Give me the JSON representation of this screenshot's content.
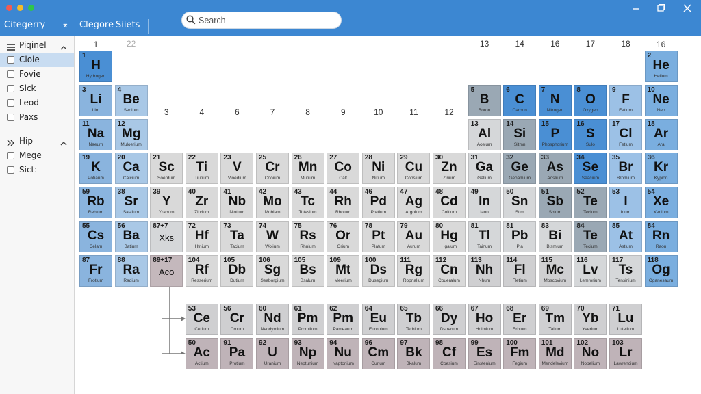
{
  "titlebar": {
    "left_label": "Citegerry",
    "collapse_symbol": "⌅",
    "tab_category": "Clegore",
    "tab_sheets": "Siiets",
    "search_placeholder": "Search"
  },
  "sidebar": {
    "sections": [
      {
        "label": "Piqinel",
        "items": [
          "Cloie",
          "Fovie",
          "Slck",
          "Leod",
          "Paxs"
        ]
      },
      {
        "label": "Hip",
        "items": [
          "Mege",
          "Sict:"
        ]
      }
    ],
    "selected_item": "Cloie"
  },
  "colors": {
    "titlebar": "#3c87d2",
    "alkali": "#8ab4de",
    "alkaline": "#a9c8e6",
    "transition": "#d9d9d9",
    "hydrogen": "#4a8fd4",
    "nonmetal": "#4a8fd4",
    "metalloid": "#9aa8b4",
    "halogen": "#9cc1e6",
    "noble": "#7aaedf",
    "post": "#d5d7d9",
    "lanthanide": "#cfcfd1",
    "actinide": "#bfb3b8",
    "acoblock": "#c4b8bc"
  },
  "groups": [
    {
      "label": "1",
      "col": 1,
      "row": 0
    },
    {
      "label": "22",
      "col": 2,
      "row": 1,
      "faint": true
    },
    {
      "label": "3",
      "col": 3,
      "row": 3
    },
    {
      "label": "4",
      "col": 4,
      "row": 3
    },
    {
      "label": "6",
      "col": 5,
      "row": 3
    },
    {
      "label": "7",
      "col": 6,
      "row": 3
    },
    {
      "label": "8",
      "col": 7,
      "row": 3
    },
    {
      "label": "9",
      "col": 8,
      "row": 3
    },
    {
      "label": "10",
      "col": 9,
      "row": 3
    },
    {
      "label": "11",
      "col": 10,
      "row": 3
    },
    {
      "label": "12",
      "col": 11,
      "row": 3
    },
    {
      "label": "13",
      "col": 12,
      "row": 1
    },
    {
      "label": "14",
      "col": 13,
      "row": 1
    },
    {
      "label": "16",
      "col": 14,
      "row": 1
    },
    {
      "label": "17",
      "col": 15,
      "row": 1
    },
    {
      "label": "18",
      "col": 16,
      "row": 1
    },
    {
      "label": "16",
      "col": 17,
      "row": 0
    }
  ],
  "elements": [
    {
      "n": "1",
      "s": "H",
      "name": "Hydrogen",
      "col": 1,
      "row": 1,
      "c": "hydrogen"
    },
    {
      "n": "2",
      "s": "He",
      "name": "Helium",
      "col": 17,
      "row": 1,
      "c": "noble"
    },
    {
      "n": "3",
      "s": "Li",
      "name": "Lim",
      "col": 1,
      "row": 2,
      "c": "alkali"
    },
    {
      "n": "4",
      "s": "Be",
      "name": "Sedium",
      "col": 2,
      "row": 2,
      "c": "alkaline"
    },
    {
      "n": "5",
      "s": "B",
      "name": "Boron",
      "col": 12,
      "row": 2,
      "c": "metalloid"
    },
    {
      "n": "6",
      "s": "C",
      "name": "Carbon",
      "col": 13,
      "row": 2,
      "c": "nonmetal"
    },
    {
      "n": "7",
      "s": "N",
      "name": "Nitrogen",
      "col": 14,
      "row": 2,
      "c": "nonmetal"
    },
    {
      "n": "8",
      "s": "O",
      "name": "Oxygen",
      "col": 15,
      "row": 2,
      "c": "nonmetal"
    },
    {
      "n": "9",
      "s": "F",
      "name": "Fetium",
      "col": 16,
      "row": 2,
      "c": "halogen"
    },
    {
      "n": "10",
      "s": "Ne",
      "name": "Neo",
      "col": 17,
      "row": 2,
      "c": "noble"
    },
    {
      "n": "11",
      "s": "Na",
      "name": "Naeum",
      "col": 1,
      "row": 3,
      "c": "alkali"
    },
    {
      "n": "12",
      "s": "Mg",
      "name": "Muloerium",
      "col": 2,
      "row": 3,
      "c": "alkaline"
    },
    {
      "n": "13",
      "s": "Al",
      "name": "Aosium",
      "col": 12,
      "row": 3,
      "c": "post"
    },
    {
      "n": "14",
      "s": "Si",
      "name": "Sitmn",
      "col": 13,
      "row": 3,
      "c": "metalloid"
    },
    {
      "n": "15",
      "s": "P",
      "name": "Phosphorium",
      "col": 14,
      "row": 3,
      "c": "nonmetal"
    },
    {
      "n": "16",
      "s": "S",
      "name": "Sulo",
      "col": 15,
      "row": 3,
      "c": "nonmetal"
    },
    {
      "n": "17",
      "s": "Cl",
      "name": "Fetium",
      "col": 16,
      "row": 3,
      "c": "halogen"
    },
    {
      "n": "18",
      "s": "Ar",
      "name": "Ara",
      "col": 17,
      "row": 3,
      "c": "noble"
    },
    {
      "n": "19",
      "s": "K",
      "name": "Potiaum",
      "col": 1,
      "row": 4,
      "c": "alkali"
    },
    {
      "n": "20",
      "s": "Ca",
      "name": "Calcium",
      "col": 2,
      "row": 4,
      "c": "alkaline"
    },
    {
      "n": "21",
      "s": "Sc",
      "name": "Soerdum",
      "col": 3,
      "row": 4,
      "c": "transition"
    },
    {
      "n": "22",
      "s": "Ti",
      "name": "Tiutium",
      "col": 4,
      "row": 4,
      "c": "transition"
    },
    {
      "n": "23",
      "s": "V",
      "name": "Vioedium",
      "col": 5,
      "row": 4,
      "c": "transition"
    },
    {
      "n": "25",
      "s": "Cr",
      "name": "Cooium",
      "col": 6,
      "row": 4,
      "c": "transition"
    },
    {
      "n": "26",
      "s": "Mn",
      "name": "Mutium",
      "col": 7,
      "row": 4,
      "c": "transition"
    },
    {
      "n": "27",
      "s": "Co",
      "name": "Calt",
      "col": 8,
      "row": 4,
      "c": "transition"
    },
    {
      "n": "28",
      "s": "Ni",
      "name": "Nitium",
      "col": 9,
      "row": 4,
      "c": "transition"
    },
    {
      "n": "29",
      "s": "Cu",
      "name": "Copsium",
      "col": 10,
      "row": 4,
      "c": "transition"
    },
    {
      "n": "30",
      "s": "Zn",
      "name": "Zirium",
      "col": 11,
      "row": 4,
      "c": "transition"
    },
    {
      "n": "31",
      "s": "Ga",
      "name": "Gallum",
      "col": 12,
      "row": 4,
      "c": "post"
    },
    {
      "n": "32",
      "s": "Ge",
      "name": "Geoamium",
      "col": 13,
      "row": 4,
      "c": "metalloid"
    },
    {
      "n": "33",
      "s": "As",
      "name": "Aoslium",
      "col": 14,
      "row": 4,
      "c": "metalloid"
    },
    {
      "n": "34",
      "s": "Se",
      "name": "Seacium",
      "col": 15,
      "row": 4,
      "c": "nonmetal"
    },
    {
      "n": "35",
      "s": "Br",
      "name": "Bromium",
      "col": 16,
      "row": 4,
      "c": "halogen"
    },
    {
      "n": "36",
      "s": "Kr",
      "name": "Kypion",
      "col": 17,
      "row": 4,
      "c": "noble"
    },
    {
      "n": "59",
      "s": "Rb",
      "name": "Rebium",
      "col": 1,
      "row": 5,
      "c": "alkali"
    },
    {
      "n": "38",
      "s": "Sr",
      "name": "Sastium",
      "col": 2,
      "row": 5,
      "c": "alkaline"
    },
    {
      "n": "39",
      "s": "Y",
      "name": "Yrabum",
      "col": 3,
      "row": 5,
      "c": "transition"
    },
    {
      "n": "40",
      "s": "Zr",
      "name": "Zircium",
      "col": 4,
      "row": 5,
      "c": "transition"
    },
    {
      "n": "41",
      "s": "Nb",
      "name": "Niotium",
      "col": 5,
      "row": 5,
      "c": "transition"
    },
    {
      "n": "42",
      "s": "Mo",
      "name": "Mobiam",
      "col": 6,
      "row": 5,
      "c": "transition"
    },
    {
      "n": "43",
      "s": "Tc",
      "name": "Totesium",
      "col": 7,
      "row": 5,
      "c": "transition"
    },
    {
      "n": "44",
      "s": "Rh",
      "name": "Rhoium",
      "col": 8,
      "row": 5,
      "c": "transition"
    },
    {
      "n": "46",
      "s": "Pd",
      "name": "Pretium",
      "col": 9,
      "row": 5,
      "c": "transition"
    },
    {
      "n": "47",
      "s": "Ag",
      "name": "Argoium",
      "col": 10,
      "row": 5,
      "c": "transition"
    },
    {
      "n": "48",
      "s": "Cd",
      "name": "Coitium",
      "col": 11,
      "row": 5,
      "c": "transition"
    },
    {
      "n": "49",
      "s": "In",
      "name": "Iaon",
      "col": 12,
      "row": 5,
      "c": "post"
    },
    {
      "n": "50",
      "s": "Sn",
      "name": "Stim",
      "col": 13,
      "row": 5,
      "c": "post"
    },
    {
      "n": "51",
      "s": "Sb",
      "name": "Sbium",
      "col": 14,
      "row": 5,
      "c": "metalloid"
    },
    {
      "n": "52",
      "s": "Te",
      "name": "Tecium",
      "col": 15,
      "row": 5,
      "c": "metalloid"
    },
    {
      "n": "53",
      "s": "I",
      "name": "Ioum",
      "col": 16,
      "row": 5,
      "c": "halogen"
    },
    {
      "n": "54",
      "s": "Xe",
      "name": "Xenium",
      "col": 17,
      "row": 5,
      "c": "noble"
    },
    {
      "n": "55",
      "s": "Cs",
      "name": "Celam",
      "col": 1,
      "row": 6,
      "c": "alkali"
    },
    {
      "n": "56",
      "s": "Ba",
      "name": "Batium",
      "col": 2,
      "row": 6,
      "c": "alkaline"
    },
    {
      "n": "87+7",
      "s": "",
      "name": "",
      "text": "Xks",
      "col": 3,
      "row": 6,
      "c": "post"
    },
    {
      "n": "72",
      "s": "Hf",
      "name": "Hfnium",
      "col": 4,
      "row": 6,
      "c": "transition"
    },
    {
      "n": "73",
      "s": "Ta",
      "name": "Tacium",
      "col": 5,
      "row": 6,
      "c": "transition"
    },
    {
      "n": "74",
      "s": "W",
      "name": "Wolium",
      "col": 6,
      "row": 6,
      "c": "transition"
    },
    {
      "n": "75",
      "s": "Rs",
      "name": "Rhnium",
      "col": 7,
      "row": 6,
      "c": "transition"
    },
    {
      "n": "76",
      "s": "Or",
      "name": "Orium",
      "col": 8,
      "row": 6,
      "c": "transition"
    },
    {
      "n": "78",
      "s": "Pt",
      "name": "Platum",
      "col": 9,
      "row": 6,
      "c": "transition"
    },
    {
      "n": "79",
      "s": "Au",
      "name": "Aurum",
      "col": 10,
      "row": 6,
      "c": "transition"
    },
    {
      "n": "80",
      "s": "Hg",
      "name": "Hgalum",
      "col": 11,
      "row": 6,
      "c": "transition"
    },
    {
      "n": "81",
      "s": "Tl",
      "name": "Tainum",
      "col": 12,
      "row": 6,
      "c": "post"
    },
    {
      "n": "81",
      "s": "Pb",
      "name": "Pla",
      "col": 13,
      "row": 6,
      "c": "post"
    },
    {
      "n": "83",
      "s": "Bi",
      "name": "Bismium",
      "col": 14,
      "row": 6,
      "c": "post"
    },
    {
      "n": "84",
      "s": "Te",
      "name": "Tecium",
      "col": 15,
      "row": 6,
      "c": "metalloid"
    },
    {
      "n": "85",
      "s": "At",
      "name": "Astium",
      "col": 16,
      "row": 6,
      "c": "halogen"
    },
    {
      "n": "84",
      "s": "Rn",
      "name": "Raon",
      "col": 17,
      "row": 6,
      "c": "noble"
    },
    {
      "n": "87",
      "s": "Fr",
      "name": "Frotium",
      "col": 1,
      "row": 7,
      "c": "alkali"
    },
    {
      "n": "88",
      "s": "Ra",
      "name": "Radium",
      "col": 2,
      "row": 7,
      "c": "alkaline"
    },
    {
      "n": "89+17",
      "s": "",
      "name": "",
      "text": "Aco",
      "col": 3,
      "row": 7,
      "c": "acoblock"
    },
    {
      "n": "104",
      "s": "Rf",
      "name": "Resserium",
      "col": 4,
      "row": 7,
      "c": "transition"
    },
    {
      "n": "105",
      "s": "Db",
      "name": "Dutium",
      "col": 5,
      "row": 7,
      "c": "transition"
    },
    {
      "n": "106",
      "s": "Sg",
      "name": "Seaborgium",
      "col": 6,
      "row": 7,
      "c": "transition"
    },
    {
      "n": "105",
      "s": "Bs",
      "name": "Bsalum",
      "col": 7,
      "row": 7,
      "c": "transition"
    },
    {
      "n": "109",
      "s": "Mt",
      "name": "Meerium",
      "col": 8,
      "row": 7,
      "c": "transition"
    },
    {
      "n": "100",
      "s": "Ds",
      "name": "Dusegium",
      "col": 9,
      "row": 7,
      "c": "transition"
    },
    {
      "n": "111",
      "s": "Rg",
      "name": "Ropnalium",
      "col": 10,
      "row": 7,
      "c": "transition"
    },
    {
      "n": "112",
      "s": "Cn",
      "name": "Coueralum",
      "col": 11,
      "row": 7,
      "c": "transition"
    },
    {
      "n": "113",
      "s": "Nh",
      "name": "Nhum",
      "col": 12,
      "row": 7,
      "c": "lanthanide"
    },
    {
      "n": "114",
      "s": "Fl",
      "name": "Fletium",
      "col": 13,
      "row": 7,
      "c": "lanthanide"
    },
    {
      "n": "115",
      "s": "Mc",
      "name": "Moscovium",
      "col": 14,
      "row": 7,
      "c": "lanthanide"
    },
    {
      "n": "116",
      "s": "Lv",
      "name": "Lemrorium",
      "col": 15,
      "row": 7,
      "c": "post"
    },
    {
      "n": "117",
      "s": "Ts",
      "name": "Tensinium",
      "col": 16,
      "row": 7,
      "c": "post"
    },
    {
      "n": "118",
      "s": "Og",
      "name": "Oganesaum",
      "col": 17,
      "row": 7,
      "c": "noble"
    },
    {
      "n": "53",
      "s": "Ce",
      "name": "Cerium",
      "col": 4,
      "row": 8,
      "c": "lanthanide"
    },
    {
      "n": "56",
      "s": "Cr",
      "name": "Crnum",
      "col": 5,
      "row": 8,
      "c": "lanthanide"
    },
    {
      "n": "60",
      "s": "Nd",
      "name": "Neodymium",
      "col": 6,
      "row": 8,
      "c": "lanthanide"
    },
    {
      "n": "61",
      "s": "Pm",
      "name": "Promtium",
      "col": 7,
      "row": 8,
      "c": "lanthanide"
    },
    {
      "n": "62",
      "s": "Pm",
      "name": "Pameaum",
      "col": 8,
      "row": 8,
      "c": "lanthanide"
    },
    {
      "n": "64",
      "s": "Eu",
      "name": "Europium",
      "col": 9,
      "row": 8,
      "c": "lanthanide"
    },
    {
      "n": "65",
      "s": "Tb",
      "name": "Terbium",
      "col": 10,
      "row": 8,
      "c": "lanthanide"
    },
    {
      "n": "66",
      "s": "Dy",
      "name": "Dsperum",
      "col": 11,
      "row": 8,
      "c": "lanthanide"
    },
    {
      "n": "67",
      "s": "Ho",
      "name": "Holmium",
      "col": 12,
      "row": 8,
      "c": "lanthanide"
    },
    {
      "n": "68",
      "s": "Er",
      "name": "Erbium",
      "col": 13,
      "row": 8,
      "c": "lanthanide"
    },
    {
      "n": "69",
      "s": "Tm",
      "name": "Talium",
      "col": 14,
      "row": 8,
      "c": "lanthanide"
    },
    {
      "n": "70",
      "s": "Yb",
      "name": "Yaerium",
      "col": 15,
      "row": 8,
      "c": "lanthanide"
    },
    {
      "n": "71",
      "s": "Lu",
      "name": "Lutetium",
      "col": 16,
      "row": 8,
      "c": "lanthanide"
    },
    {
      "n": "50",
      "s": "Ac",
      "name": "Actium",
      "col": 4,
      "row": 9,
      "c": "actinide"
    },
    {
      "n": "91",
      "s": "Pa",
      "name": "Protium",
      "col": 5,
      "row": 9,
      "c": "actinide"
    },
    {
      "n": "92",
      "s": "U",
      "name": "Uranium",
      "col": 6,
      "row": 9,
      "c": "actinide"
    },
    {
      "n": "93",
      "s": "Np",
      "name": "Neptunium",
      "col": 7,
      "row": 9,
      "c": "actinide"
    },
    {
      "n": "94",
      "s": "Nu",
      "name": "Naptonium",
      "col": 8,
      "row": 9,
      "c": "actinide"
    },
    {
      "n": "96",
      "s": "Cm",
      "name": "Curium",
      "col": 9,
      "row": 9,
      "c": "actinide"
    },
    {
      "n": "97",
      "s": "Bk",
      "name": "Bkalum",
      "col": 10,
      "row": 9,
      "c": "actinide"
    },
    {
      "n": "98",
      "s": "Cf",
      "name": "Coesium",
      "col": 11,
      "row": 9,
      "c": "actinide"
    },
    {
      "n": "99",
      "s": "Es",
      "name": "Einstenium",
      "col": 12,
      "row": 9,
      "c": "actinide"
    },
    {
      "n": "100",
      "s": "Fm",
      "name": "Fegium",
      "col": 13,
      "row": 9,
      "c": "actinide"
    },
    {
      "n": "101",
      "s": "Md",
      "name": "Mendelevium",
      "col": 14,
      "row": 9,
      "c": "actinide"
    },
    {
      "n": "102",
      "s": "No",
      "name": "Nobelium",
      "col": 15,
      "row": 9,
      "c": "actinide"
    },
    {
      "n": "103",
      "s": "Lr",
      "name": "Lawrencium",
      "col": 16,
      "row": 9,
      "c": "actinide"
    }
  ]
}
